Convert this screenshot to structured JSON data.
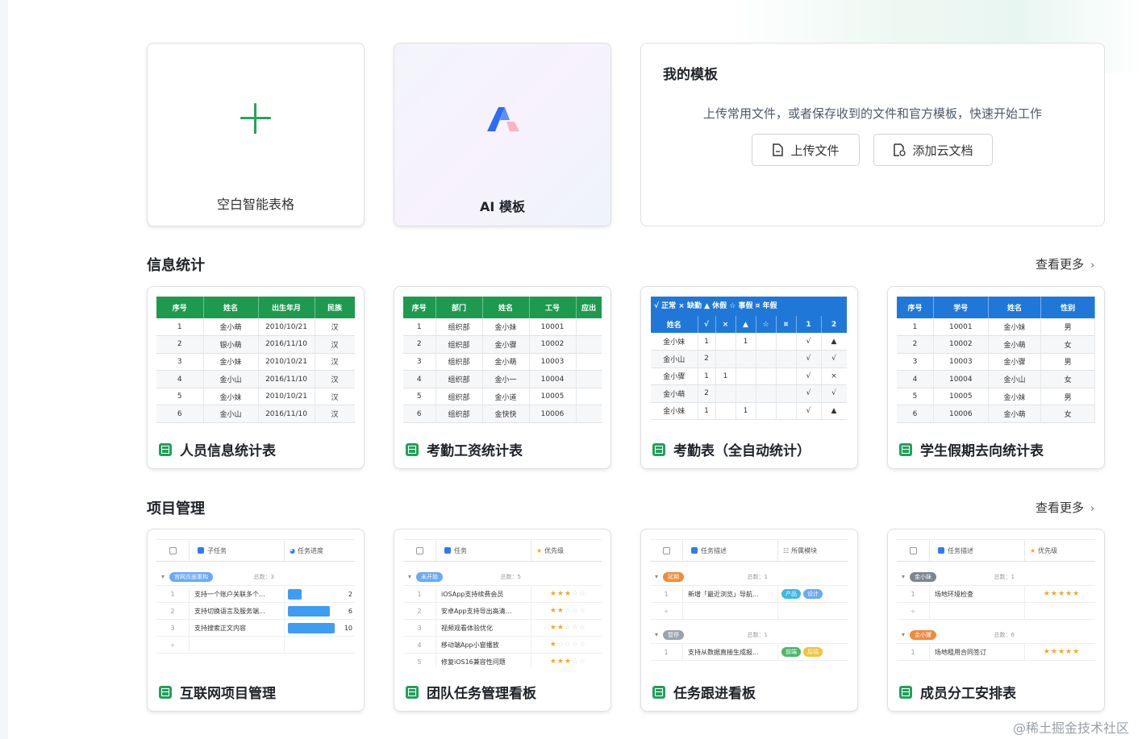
{
  "top": {
    "blank": {
      "label": "空白智能表格"
    },
    "ai": {
      "label": "AI 模板"
    },
    "my_templates": {
      "title": "我的模板",
      "desc": "上传常用文件，或者保存收到的文件和官方模板，快速开始工作",
      "upload": "上传文件",
      "add_cloud": "添加云文档"
    }
  },
  "sections": {
    "info": {
      "title": "信息统计",
      "more": "查看更多"
    },
    "project": {
      "title": "项目管理",
      "more": "查看更多"
    }
  },
  "info_cards": {
    "c1": {
      "name": "人员信息统计表",
      "headers": [
        "序号",
        "姓名",
        "出生年月",
        "民族"
      ],
      "rows": [
        [
          "1",
          "金小萌",
          "2010/10/21",
          "汉"
        ],
        [
          "2",
          "银小萌",
          "2016/11/10",
          "汉"
        ],
        [
          "3",
          "金小妹",
          "2010/10/21",
          "汉"
        ],
        [
          "4",
          "金小山",
          "2016/11/10",
          "汉"
        ],
        [
          "5",
          "金小妹",
          "2010/10/21",
          "汉"
        ],
        [
          "6",
          "金小山",
          "2016/11/10",
          "汉"
        ]
      ]
    },
    "c2": {
      "name": "考勤工资统计表",
      "headers": [
        "序号",
        "部门",
        "姓名",
        "工号",
        "应出"
      ],
      "rows": [
        [
          "1",
          "组织部",
          "金小妹",
          "10001",
          ""
        ],
        [
          "2",
          "组织部",
          "金小骤",
          "10002",
          ""
        ],
        [
          "3",
          "组织部",
          "金小萌",
          "10003",
          ""
        ],
        [
          "4",
          "组织部",
          "金小一",
          "10004",
          ""
        ],
        [
          "5",
          "组织部",
          "金小道",
          "10005",
          ""
        ],
        [
          "6",
          "组织部",
          "金快快",
          "10006",
          ""
        ]
      ]
    },
    "c3": {
      "name": "考勤表（全自动统计）",
      "legend": "√ 正常 × 缺勤 ▲ 休假 ☆ 事假 ¤ 年假",
      "headers": [
        "姓名",
        "√",
        "×",
        "▲",
        "☆",
        "¤",
        "1",
        "2"
      ],
      "rows": [
        [
          "金小妹",
          "1",
          "",
          "1",
          "",
          "",
          "√",
          "▲"
        ],
        [
          "金小山",
          "2",
          "",
          "",
          "",
          "",
          "√",
          "√"
        ],
        [
          "金小骤",
          "1",
          "1",
          "",
          "",
          "",
          "√",
          "×"
        ],
        [
          "金小萌",
          "2",
          "",
          "",
          "",
          "",
          "√",
          "√"
        ],
        [
          "金小妹",
          "1",
          "",
          "1",
          "",
          "",
          "√",
          "▲"
        ]
      ]
    },
    "c4": {
      "name": "学生假期去向统计表",
      "headers": [
        "序号",
        "学号",
        "姓名",
        "性别"
      ],
      "rows": [
        [
          "1",
          "10001",
          "金小妹",
          "男"
        ],
        [
          "2",
          "10002",
          "金小萌",
          "女"
        ],
        [
          "3",
          "10003",
          "金小骤",
          "男"
        ],
        [
          "4",
          "10004",
          "金小山",
          "女"
        ],
        [
          "5",
          "10005",
          "金小妹",
          "男"
        ],
        [
          "6",
          "10006",
          "金小萌",
          "女"
        ]
      ]
    }
  },
  "project_cards": {
    "p1": {
      "name": "互联网项目管理",
      "col1": "子任务",
      "col2": "任务进度",
      "group": "官网页面重构",
      "count": "总数：3",
      "rows": [
        {
          "n": "1",
          "t": "支持一个账户关联多个...",
          "v": "2",
          "pct": 0.3
        },
        {
          "n": "2",
          "t": "支持切换语言及服务端...",
          "v": "6",
          "pct": 0.9
        },
        {
          "n": "3",
          "t": "支持搜索正文内容",
          "v": "10",
          "pct": 1.0
        }
      ]
    },
    "p2": {
      "name": "团队任务管理看板",
      "col1": "任务",
      "col2": "优先级",
      "group": "未开始",
      "count": "总数：5",
      "rows": [
        {
          "n": "1",
          "t": "iOSApp支持续费会员",
          "stars": 3
        },
        {
          "n": "2",
          "t": "安卓App支持导出高清...",
          "stars": 2
        },
        {
          "n": "3",
          "t": "视频观看体验优化",
          "stars": 2
        },
        {
          "n": "4",
          "t": "移动端App小窗播放",
          "stars": 1
        },
        {
          "n": "5",
          "t": "修复iOS16兼容性问题",
          "stars": 3
        }
      ]
    },
    "p3": {
      "name": "任务跟进看板",
      "col1": "任务描述",
      "col2": "所属模块",
      "group1": "延期",
      "count1": "总数：1",
      "row1": {
        "n": "1",
        "t": "新增「最近浏览」导航...",
        "tags": [
          "产品",
          "设计"
        ]
      },
      "group2": "暂停",
      "count2": "总数：1",
      "row2": {
        "n": "1",
        "t": "支持从数据直接生成报...",
        "tags": [
          "前端",
          "后端"
        ]
      }
    },
    "p4": {
      "name": "成员分工安排表",
      "col1": "任务描述",
      "col2": "优先级",
      "group1": "金小妹",
      "count1": "总数：1",
      "row1": {
        "n": "1",
        "t": "场地环境检查",
        "stars": 5
      },
      "group2": "金小骤",
      "count2": "总数：6",
      "row2": {
        "n": "1",
        "t": "场地租用合同签订",
        "stars": 5
      }
    }
  },
  "watermark": "@稀土掘金技术社区",
  "colors": {
    "green": "#1e9a4f",
    "blue": "#1f78d8",
    "accent": "#27a35a"
  }
}
